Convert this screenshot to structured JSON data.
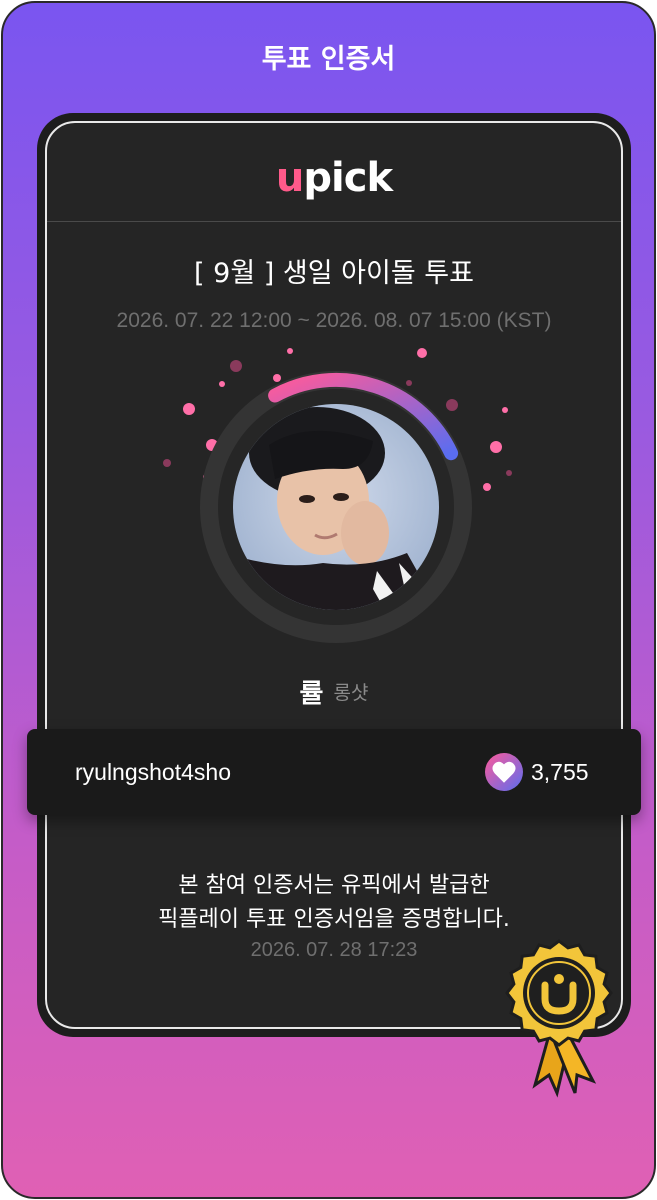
{
  "header": {
    "title": "투표 인증서"
  },
  "logo": {
    "text_u": "u",
    "text_rest": "pick"
  },
  "vote": {
    "title": "[ 9월 ] 생일 아이돌 투표",
    "period": "2026. 07. 22 12:00 ~ 2026. 08. 07 15:00 (KST)"
  },
  "candidate": {
    "name": "률",
    "group": "롱샷",
    "progress_fraction": 0.26
  },
  "voter": {
    "username": "ryulngshot4sho",
    "vote_count": "3,755"
  },
  "certificate": {
    "line1": "본 참여 인증서는 유픽에서 발급한",
    "line2": "픽플레이 투표 인증서임을 증명합니다.",
    "issued_at": "2026. 07. 28 17:23"
  },
  "colors": {
    "bg_top": "#7a55f0",
    "bg_bottom": "#e060b4",
    "card": "#252525",
    "accent_pink": "#ff5a9a",
    "accent_blue": "#5a6df0",
    "medal_gold": "#f2c53a"
  },
  "icons": {
    "vote": "heart-icon",
    "medal": "upick-medal-icon"
  }
}
